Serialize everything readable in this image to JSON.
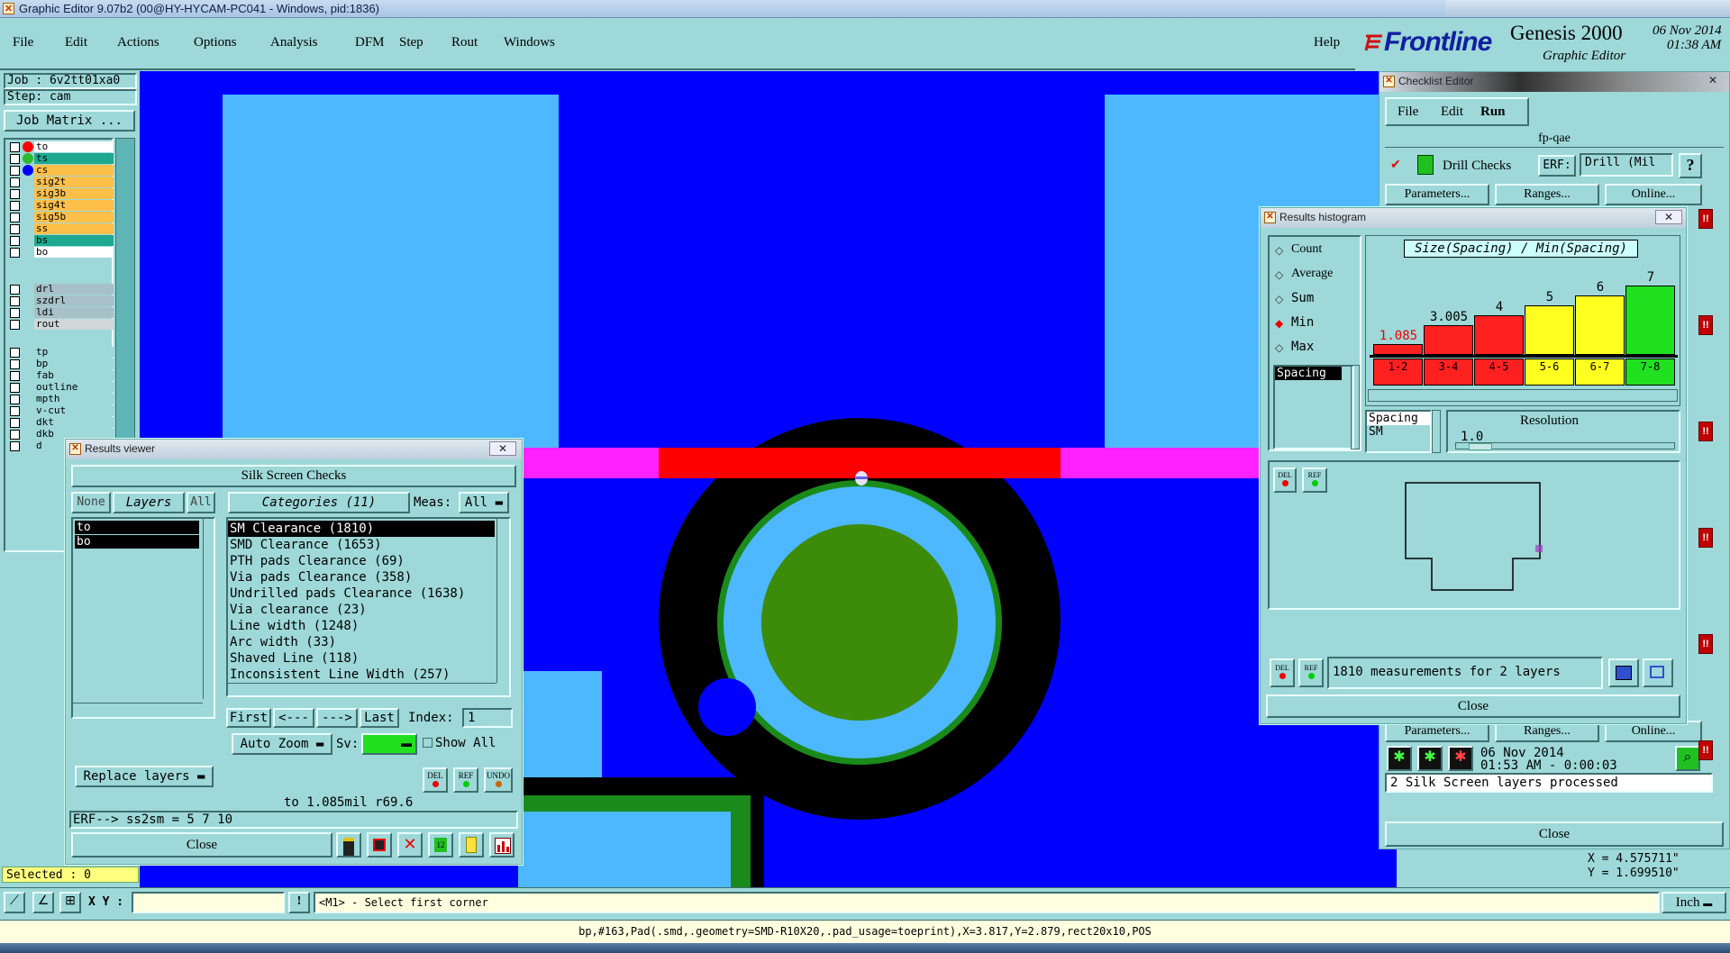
{
  "window_title": "Graphic Editor 9.07b2 (00@HY-HYCAM-PC041 - Windows, pid:1836)",
  "menu": [
    "File",
    "Edit",
    "Actions",
    "Options",
    "Analysis",
    "DFM",
    "Step",
    "Rout",
    "Windows"
  ],
  "help_label": "Help",
  "brand": {
    "logo": "Frontline",
    "product": "Genesis 2000",
    "subtitle": "Graphic Editor",
    "date": "06 Nov 2014",
    "time": "01:38 AM"
  },
  "job": {
    "job_label": "Job : 6v2tt01xa0",
    "step_label": "Step: cam",
    "matrix_button": "Job Matrix ..."
  },
  "layers_group1": [
    {
      "name": "to",
      "color": "#ffffff",
      "dot": "#ff0000"
    },
    {
      "name": "ts",
      "color": "#1fa890",
      "dot": "#2eb82e"
    },
    {
      "name": "cs",
      "color": "#ffc04a",
      "dot": "#0000ff"
    },
    {
      "name": "sig2t",
      "color": "#ffc04a",
      "dot": ""
    },
    {
      "name": "sig3b",
      "color": "#ffc04a",
      "dot": ""
    },
    {
      "name": "sig4t",
      "color": "#ffc04a",
      "dot": ""
    },
    {
      "name": "sig5b",
      "color": "#ffc04a",
      "dot": ""
    },
    {
      "name": "ss",
      "color": "#ffc04a",
      "dot": ""
    },
    {
      "name": "bs",
      "color": "#1fa890",
      "dot": ""
    },
    {
      "name": "bo",
      "color": "#ffffff",
      "dot": ""
    }
  ],
  "layers_group2": [
    {
      "name": "drl",
      "color": "#a8c0c8"
    },
    {
      "name": "szdrl",
      "color": "#a8c0c8"
    },
    {
      "name": "ldi",
      "color": "#a8c0c8"
    },
    {
      "name": "rout",
      "color": "#d0d8d8"
    }
  ],
  "layers_group3": [
    {
      "name": "tp",
      "color": "#9ed8d8"
    },
    {
      "name": "bp",
      "color": "#9ed8d8"
    },
    {
      "name": "fab",
      "color": "#9ed8d8"
    },
    {
      "name": "outline",
      "color": "#9ed8d8"
    },
    {
      "name": "mpth",
      "color": "#9ed8d8"
    },
    {
      "name": "v-cut",
      "color": "#9ed8d8"
    },
    {
      "name": "dkt",
      "color": "#9ed8d8"
    },
    {
      "name": "dkb",
      "color": "#9ed8d8"
    },
    {
      "name": "d",
      "color": "#9ed8d8"
    }
  ],
  "selected_label": "Selected : 0",
  "results_viewer": {
    "title": "Results viewer",
    "header": "Silk Screen Checks",
    "none": "None",
    "layers": "Layers",
    "all": "All",
    "categories_label": "Categories (11)",
    "meas_label": "Meas:",
    "meas_value": "All",
    "layer_items": [
      "to",
      "bo"
    ],
    "categories": [
      "SM Clearance (1810)",
      "SMD Clearance (1653)",
      "PTH pads Clearance (69)",
      "Via pads Clearance (358)",
      "Undrilled pads Clearance (1638)",
      "Via clearance (23)",
      "Line width (1248)",
      "Arc width (33)",
      "Shaved Line (118)",
      "Inconsistent Line Width (257)"
    ],
    "first": "First",
    "prev": "<---",
    "next": "--->",
    "last": "Last",
    "index_label": "Index:",
    "index_value": "1",
    "auto_zoom": "Auto Zoom",
    "sv_label": "Sv:",
    "show_all": "Show All",
    "replace_layers": "Replace layers",
    "del": "DEL",
    "ref": "REF",
    "undo": "UNDO",
    "measure_text": "to 1.085mil  r69.6",
    "erf_text": "ERF--> ss2sm = 5 7 10",
    "close": "Close"
  },
  "checklist_editor": {
    "title": "Checklist Editor",
    "menu": [
      "File",
      "Edit",
      "Run"
    ],
    "name": "fp-qae",
    "check_name": "Drill Checks",
    "erf_label": "ERF:",
    "erf_value": "Drill (Mil",
    "parameters": "Parameters...",
    "ranges": "Ranges...",
    "online": "Online...",
    "run_date": "06 Nov 2014",
    "run_time": "01:53 AM - 0:00:03",
    "status": "2 Silk Screen layers processed",
    "close": "Close",
    "qmark": "?"
  },
  "histogram": {
    "title": "Results histogram",
    "options": [
      {
        "label": "Count",
        "selected": false
      },
      {
        "label": "Average",
        "selected": false
      },
      {
        "label": "Sum",
        "selected": false
      },
      {
        "label": "Min",
        "selected": true
      },
      {
        "label": "Max",
        "selected": false
      }
    ],
    "list_item": "Spacing",
    "chart_title": "Size(Spacing) / Min(Spacing)",
    "resolution_label": "Resolution",
    "resolution_value": "1.0",
    "info_a": "Spacing",
    "info_b": "SM",
    "measurements_text": "1810 measurements for 2 layers",
    "close": "Close",
    "del": "DEL",
    "ref": "REF"
  },
  "chart_data": {
    "type": "bar",
    "title": "Size(Spacing) / Min(Spacing)",
    "categories": [
      "1-2",
      "3-4",
      "4-5",
      "5-6",
      "6-7",
      "7-8"
    ],
    "values": [
      1.085,
      3.005,
      4,
      5,
      6,
      7
    ],
    "value_labels": [
      "1.085",
      "3.005",
      "4",
      "5",
      "6",
      "7"
    ],
    "colors": [
      "#ff2020",
      "#ff2020",
      "#ff2020",
      "#ffff20",
      "#ffff20",
      "#20e020"
    ],
    "ylim": [
      0,
      7.8
    ]
  },
  "coords": {
    "x": "X = 4.575711\"",
    "y": "Y = 1.699510\""
  },
  "bottom": {
    "xy_label": "X Y :",
    "prompt": "<M1> - Select first corner",
    "units": "Inch"
  },
  "status_line": "bp,#163,Pad(.smd,.geometry=SMD-R10X20,.pad_usage=toeprint),X=3.817,Y=2.879,rect20x10,POS"
}
